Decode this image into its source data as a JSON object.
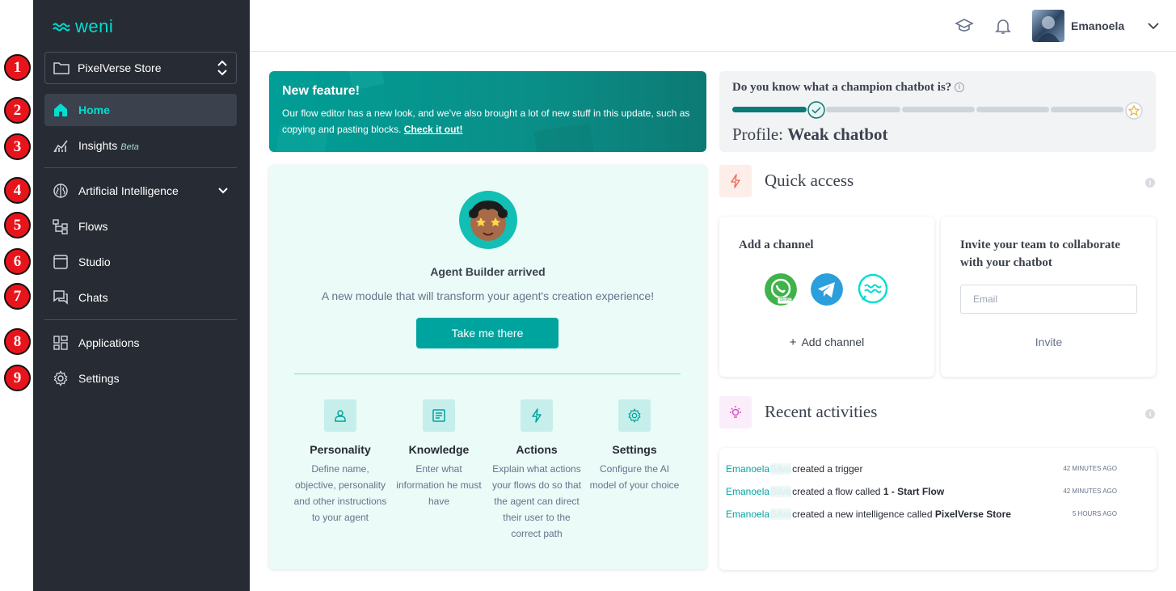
{
  "annotations": [
    "1",
    "2",
    "3",
    "4",
    "5",
    "6",
    "7",
    "8",
    "9"
  ],
  "sidebar": {
    "logo_text": "weni",
    "project": "PixelVerse Store",
    "items": [
      {
        "label": "Home",
        "icon": "home-icon"
      },
      {
        "label": "Insights",
        "badge": "Beta",
        "icon": "insights-icon"
      },
      {
        "label": "Artificial Intelligence",
        "icon": "brain-icon"
      },
      {
        "label": "Flows",
        "icon": "flows-icon"
      },
      {
        "label": "Studio",
        "icon": "studio-icon"
      },
      {
        "label": "Chats",
        "icon": "chats-icon"
      },
      {
        "label": "Applications",
        "icon": "applications-icon"
      },
      {
        "label": "Settings",
        "icon": "gear-icon"
      }
    ]
  },
  "topbar": {
    "user_name": "Emanoela"
  },
  "banner": {
    "title": "New feature!",
    "text": "Our flow editor has a new look, and we've also brought a lot of new stuff in this update, such as copying and pasting blocks.",
    "link": "Check it out!"
  },
  "champion": {
    "question": "Do you know what a champion chatbot is?",
    "profile_label": "Profile:",
    "profile_value": "Weak chatbot",
    "progress_fraction": 0.2
  },
  "agent_builder": {
    "title": "Agent Builder arrived",
    "description": "A new module that will transform your agent's creation experience!",
    "button": "Take me there",
    "features": [
      {
        "title": "Personality",
        "desc": "Define name, objective, personality and other instructions to your agent",
        "icon": "person-icon"
      },
      {
        "title": "Knowledge",
        "desc": "Enter what information he must have",
        "icon": "document-icon"
      },
      {
        "title": "Actions",
        "desc": "Explain what actions your flows do so that the agent can direct their user to the correct path",
        "icon": "lightning-icon"
      },
      {
        "title": "Settings",
        "desc": "Configure the AI model of your choice",
        "icon": "gear-icon"
      }
    ]
  },
  "quick_access": {
    "title": "Quick access",
    "add_channel_title": "Add a channel",
    "whatsapp_demo": "DEMO",
    "add_channel_link": "Add channel",
    "invite_title": "Invite your team to collaborate with your chatbot",
    "email_placeholder": "Email",
    "invite_button": "Invite"
  },
  "recent": {
    "title": "Recent activities",
    "items": [
      {
        "user": "Emanoela",
        "surname": "Silva",
        "action": "created a trigger",
        "target": "",
        "time": "42 MINUTES AGO"
      },
      {
        "user": "Emanoela",
        "surname": "Silva",
        "action": "created a flow called",
        "target": "1 - Start Flow",
        "time": "42 MINUTES AGO"
      },
      {
        "user": "Emanoela",
        "surname": "Silva",
        "action": "created a new intelligence called",
        "target": "PixelVerse Store",
        "time": "5 HOURS AGO"
      }
    ]
  },
  "colors": {
    "sidebar_bg": "#272b33",
    "accent": "#00ded2",
    "primary": "#00a49f",
    "annotation": "#e8141c"
  }
}
